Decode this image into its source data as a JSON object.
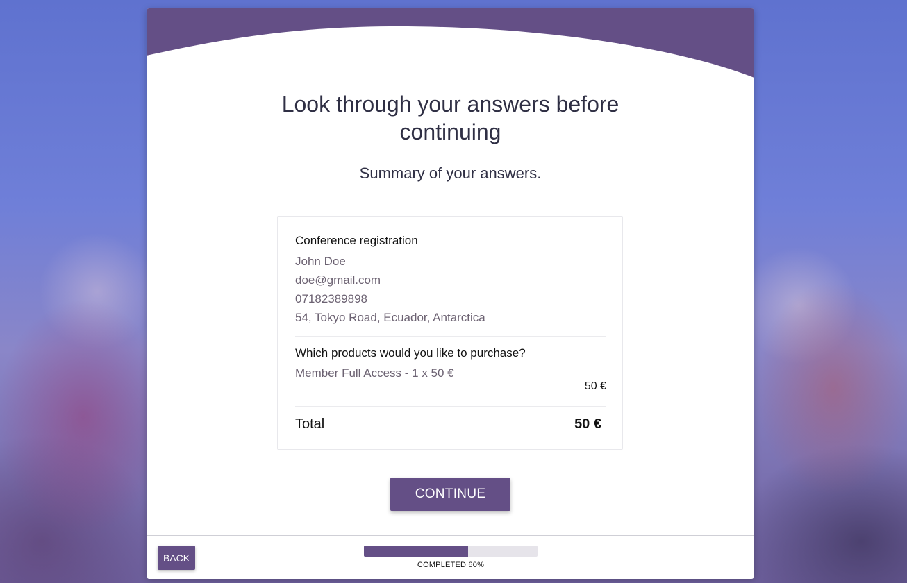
{
  "colors": {
    "accent": "#644f86",
    "wave": "#644f86",
    "title_text": "#2f2f44",
    "answer_text": "#6c6272",
    "progress_track": "#e6e4ea"
  },
  "header": {
    "title_line1": "Look through your answers before",
    "title_line2": "continuing",
    "subtitle": "Summary of your answers."
  },
  "summary": {
    "registration": {
      "title": "Conference registration",
      "name": "John Doe",
      "email": "doe@gmail.com",
      "phone": "07182389898",
      "address": "54, Tokyo Road, Ecuador, Antarctica"
    },
    "products": {
      "question": "Which products would you like to purchase?",
      "item": "Member Full Access - 1 x 50 €",
      "item_price": "50 €"
    },
    "total": {
      "label": "Total",
      "value": "50 €"
    }
  },
  "actions": {
    "continue_label": "CONTINUE",
    "back_label": "BACK"
  },
  "progress": {
    "percent": 60,
    "label": "COMPLETED 60%"
  }
}
